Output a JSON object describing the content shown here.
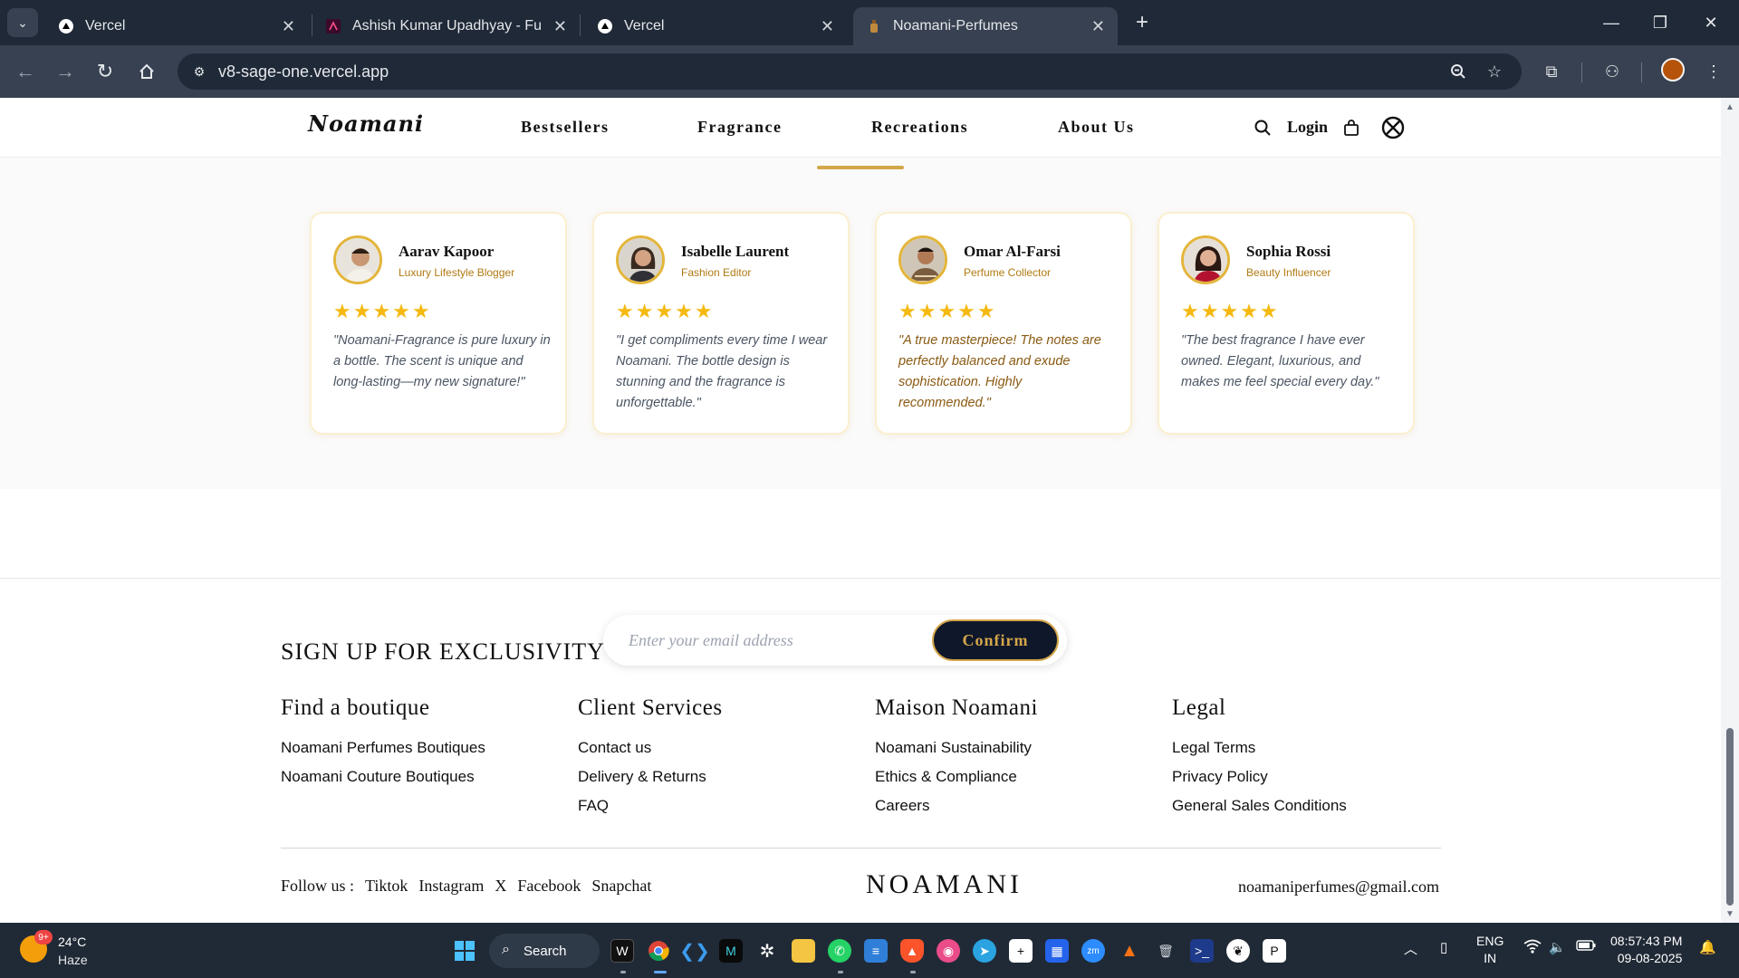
{
  "browser": {
    "tabs": [
      {
        "title": "Vercel",
        "active": false
      },
      {
        "title": "Ashish Kumar Upadhyay - Full S",
        "active": false
      },
      {
        "title": "Vercel",
        "active": false
      },
      {
        "title": "Noamani-Perfumes",
        "active": true
      }
    ],
    "url": "v8-sage-one.vercel.app"
  },
  "site": {
    "logo": "Noamani",
    "nav": [
      "Bestsellers",
      "Fragrance",
      "Recreations",
      "About Us"
    ],
    "active_nav": "Recreations",
    "login": "Login",
    "accent": "#d4a64a"
  },
  "testimonials": [
    {
      "name": "Aarav Kapoor",
      "role": "Luxury Lifestyle Blogger",
      "rating": 5,
      "stars": "★★★★★",
      "quote": "\"Noamani-Fragrance is pure luxury in a bottle. The scent is unique and long-lasting—my new signature!\""
    },
    {
      "name": "Isabelle Laurent",
      "role": "Fashion Editor",
      "rating": 5,
      "stars": "★★★★★",
      "quote": "\"I get compliments every time I wear Noamani. The bottle design is stunning and the fragrance is unforgettable.\""
    },
    {
      "name": "Omar Al-Farsi",
      "role": "Perfume Collector",
      "rating": 5,
      "stars": "★★★★★",
      "quote": "\"A true masterpiece! The notes are perfectly balanced and exude sophistication. Highly recommended.\""
    },
    {
      "name": "Sophia Rossi",
      "role": "Beauty Influencer",
      "rating": 5,
      "stars": "★★★★★",
      "quote": "\"The best fragrance I have ever owned. Elegant, luxurious, and makes me feel special every day.\""
    }
  ],
  "footer": {
    "signup_title": "SIGN UP FOR EXCLUSIVITY",
    "email_placeholder": "Enter your email address",
    "confirm_label": "Confirm",
    "columns": [
      {
        "heading": "Find a boutique",
        "links": [
          "Noamani Perfumes Boutiques",
          "Noamani Couture Boutiques"
        ]
      },
      {
        "heading": "Client Services",
        "links": [
          "Contact us",
          "Delivery & Returns",
          "FAQ"
        ]
      },
      {
        "heading": "Maison Noamani",
        "links": [
          "Noamani Sustainability",
          "Ethics & Compliance",
          "Careers"
        ]
      },
      {
        "heading": "Legal",
        "links": [
          "Legal Terms",
          "Privacy Policy",
          "General Sales Conditions"
        ]
      }
    ],
    "follow_label": "Follow us :",
    "socials": [
      "Tiktok",
      "Instagram",
      "X",
      "Facebook",
      "Snapchat"
    ],
    "brand": "NOAMANI",
    "email": "noamaniperfumes@gmail.com"
  },
  "taskbar": {
    "weather_temp": "24°C",
    "weather_desc": "Haze",
    "weather_badge": "9+",
    "search_label": "Search",
    "lang_top": "ENG",
    "lang_bottom": "IN",
    "time": "08:57:43 PM",
    "date": "09-08-2025"
  }
}
